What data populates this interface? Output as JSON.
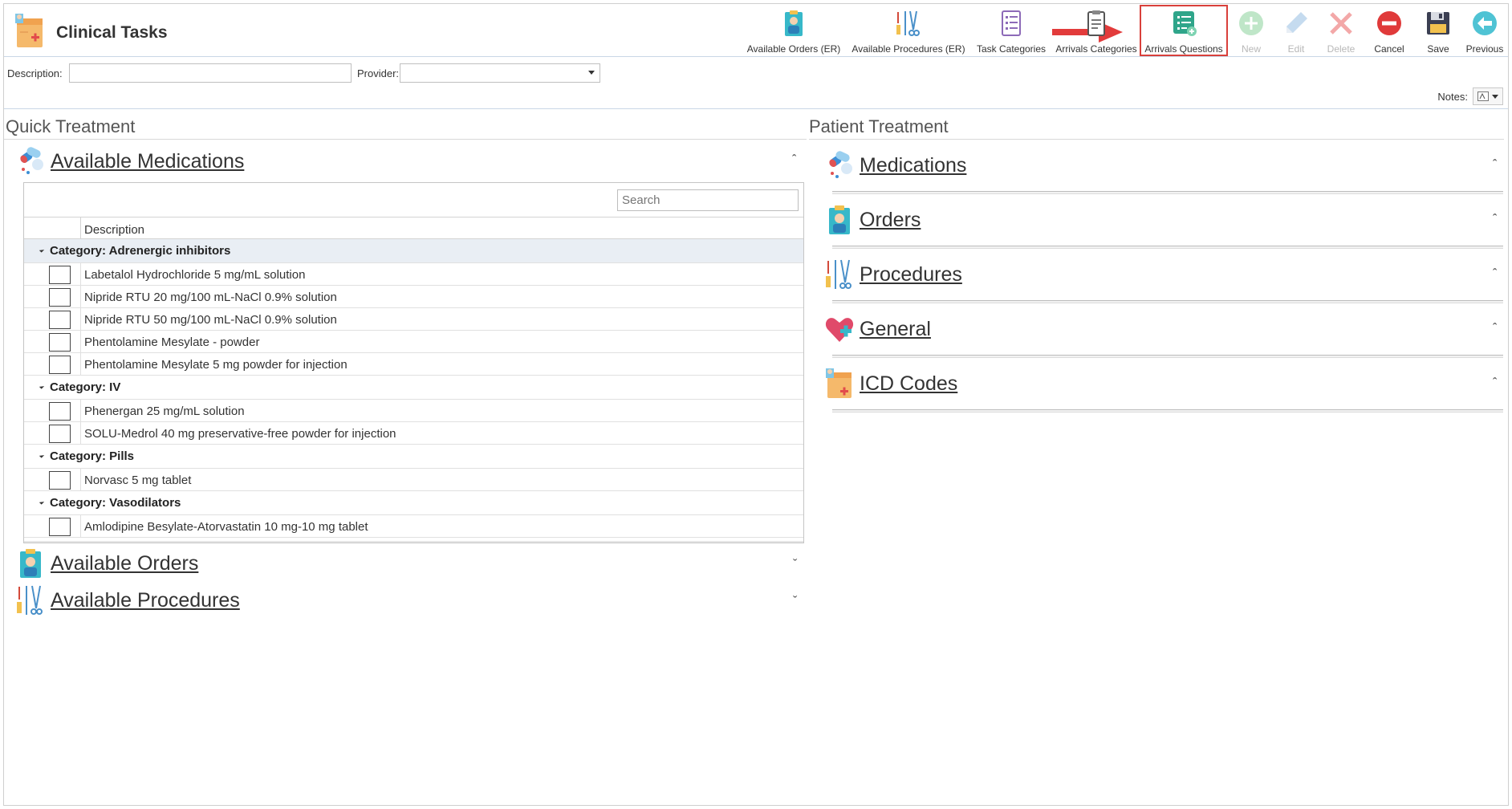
{
  "app": {
    "title": "Clinical Tasks"
  },
  "toolbar": {
    "buttons": [
      {
        "id": "available-orders-er",
        "label": "Available Orders (ER)",
        "icon": "clipboard-doctor-icon",
        "disabled": false
      },
      {
        "id": "available-procedures-er",
        "label": "Available Procedures (ER)",
        "icon": "surgical-tools-icon",
        "disabled": false
      },
      {
        "id": "task-categories",
        "label": "Task Categories",
        "icon": "checklist-icon",
        "disabled": false
      },
      {
        "id": "arrivals-categories",
        "label": "Arrivals Categories",
        "icon": "clipboard-icon",
        "disabled": false
      },
      {
        "id": "arrivals-questions",
        "label": "Arrivals Questions",
        "icon": "question-list-icon",
        "disabled": false,
        "highlighted": true
      },
      {
        "id": "new",
        "label": "New",
        "icon": "plus-circle-icon",
        "disabled": true
      },
      {
        "id": "edit",
        "label": "Edit",
        "icon": "pencil-icon",
        "disabled": true
      },
      {
        "id": "delete",
        "label": "Delete",
        "icon": "x-icon",
        "disabled": true
      },
      {
        "id": "cancel",
        "label": "Cancel",
        "icon": "no-entry-icon",
        "disabled": false
      },
      {
        "id": "save",
        "label": "Save",
        "icon": "floppy-disk-icon",
        "disabled": false
      },
      {
        "id": "previous",
        "label": "Previous",
        "icon": "back-arrow-circle-icon",
        "disabled": false
      }
    ]
  },
  "filters": {
    "description_label": "Description:",
    "description_value": "",
    "provider_label": "Provider:",
    "provider_value": ""
  },
  "notes": {
    "label": "Notes:"
  },
  "quick_treatment": {
    "title": "Quick Treatment",
    "medications": {
      "title": "Available Medications",
      "search_placeholder": "Search",
      "column_description": "Description",
      "categories": [
        {
          "name": "Category: Adrenergic inhibitors",
          "items": [
            "Labetalol Hydrochloride 5 mg/mL solution",
            "Nipride RTU 20 mg/100 mL-NaCl 0.9% solution",
            "Nipride RTU 50 mg/100 mL-NaCl 0.9% solution",
            "Phentolamine Mesylate - powder",
            "Phentolamine Mesylate 5 mg powder for injection"
          ]
        },
        {
          "name": "Category: IV",
          "items": [
            "Phenergan 25 mg/mL solution",
            "SOLU-Medrol 40 mg preservative-free powder for injection"
          ]
        },
        {
          "name": "Category: Pills",
          "items": [
            "Norvasc 5 mg tablet"
          ]
        },
        {
          "name": "Category: Vasodilators",
          "items": [
            "Amlodipine Besylate-Atorvastatin 10 mg-10 mg tablet"
          ]
        }
      ]
    },
    "orders_title": "Available Orders",
    "procedures_title": "Available Procedures"
  },
  "patient_treatment": {
    "title": "Patient Treatment",
    "groups": [
      "Medications",
      "Orders",
      "Procedures",
      "General",
      "ICD Codes"
    ]
  },
  "colors": {
    "accent_blue": "#c9d7e6",
    "highlight_red": "#d9403b",
    "row_highlight": "#e9eef4"
  }
}
